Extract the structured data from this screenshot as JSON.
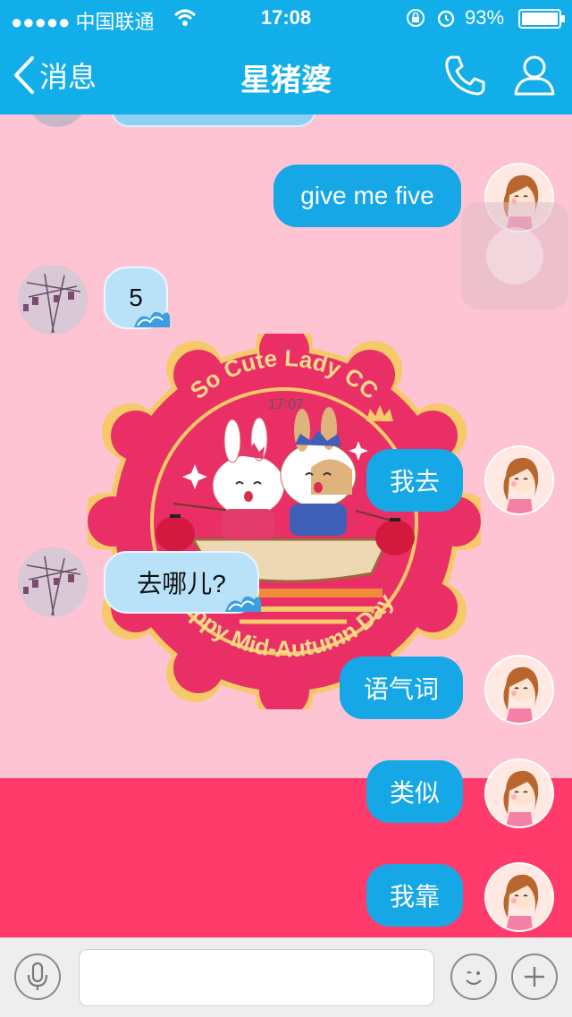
{
  "status_bar": {
    "carrier": "●●●●● 中国联通",
    "time": "17:08",
    "battery": "93%"
  },
  "nav": {
    "back_label": "消息",
    "title": "星猪婆"
  },
  "chat": {
    "timestamp": "17:07",
    "messages": [
      {
        "from": "me",
        "text": "give me five"
      },
      {
        "from": "them",
        "text": "5"
      },
      {
        "from": "me",
        "text": "我去"
      },
      {
        "from": "them",
        "text": "去哪儿?"
      },
      {
        "from": "me",
        "text": "语气词"
      },
      {
        "from": "me",
        "text": "类似"
      },
      {
        "from": "me",
        "text": "我靠"
      }
    ],
    "sticker": {
      "top_text": "So Cute Lady CC",
      "bottom_text": "Happy Mid-Autumn Day"
    }
  },
  "input_bar": {
    "message_value": "",
    "icons": [
      "microphone-icon",
      "emoji-icon",
      "plus-icon"
    ]
  },
  "colors": {
    "header": "#12aeea",
    "chat_background": "#ffc4d3",
    "chat_background_lower": "#ff3b6c",
    "outgoing_bubble": "#15a7e6",
    "incoming_bubble": "#b9e1f7"
  }
}
